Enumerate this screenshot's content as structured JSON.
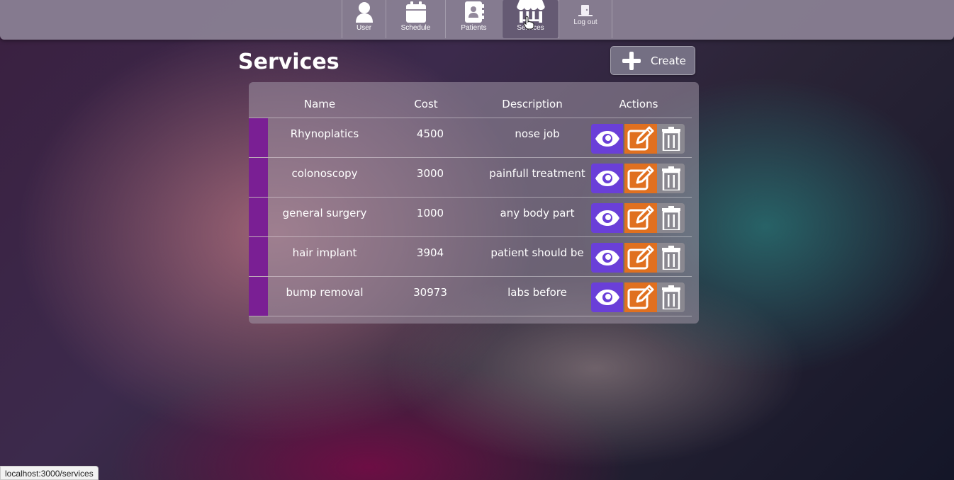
{
  "nav": {
    "items": [
      {
        "label": "User",
        "icon": "user-icon"
      },
      {
        "label": "Schedule",
        "icon": "calendar-icon"
      },
      {
        "label": "Patients",
        "icon": "address-book-icon"
      },
      {
        "label": "Services",
        "icon": "store-icon",
        "active": true
      },
      {
        "label": "Log out",
        "icon": "door-icon"
      }
    ]
  },
  "page": {
    "title": "Services",
    "create_label": "Create"
  },
  "table": {
    "headers": [
      "Name",
      "Cost",
      "Description",
      "Actions"
    ],
    "rows": [
      {
        "name": "Rhynoplatics",
        "cost": "4500",
        "description": "nose job"
      },
      {
        "name": "colonoscopy",
        "cost": "3000",
        "description": "painfull treatment"
      },
      {
        "name": "general surgery",
        "cost": "1000",
        "description": "any body part"
      },
      {
        "name": "hair implant",
        "cost": "3904",
        "description": "patient should be"
      },
      {
        "name": "bump removal",
        "cost": "30973",
        "description": "labs before"
      }
    ]
  },
  "colors": {
    "row_accent": "#7a1f94",
    "view": "#6a3fd8",
    "edit": "#e07020",
    "delete": "#8a8890"
  },
  "status_bar": {
    "url": "localhost:3000/services"
  }
}
